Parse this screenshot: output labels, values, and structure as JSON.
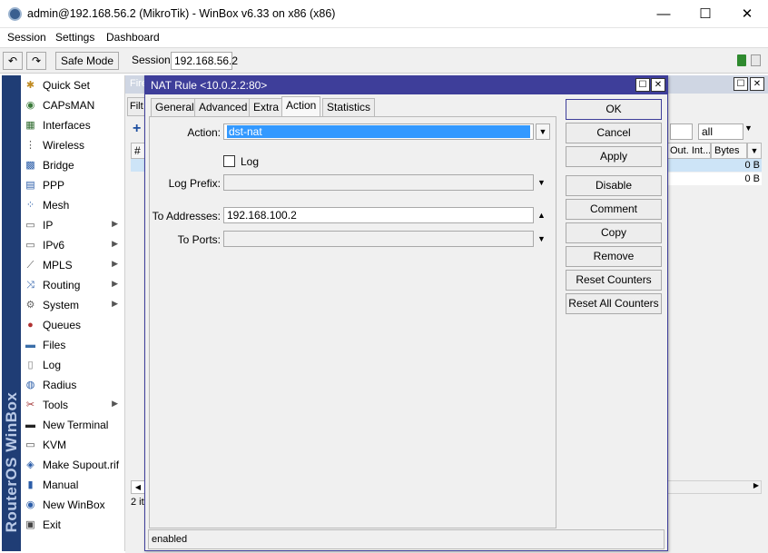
{
  "window": {
    "title": "admin@192.168.56.2 (MikroTik) - WinBox v6.33 on x86 (x86)",
    "controls": {
      "minimize": "—",
      "maximize": "☐",
      "close": "✕"
    }
  },
  "menu": [
    "Session",
    "Settings",
    "Dashboard"
  ],
  "toolbar": {
    "undo_icon": "↶",
    "redo_icon": "↷",
    "safe_mode": "Safe Mode",
    "session_label": "Session:",
    "session_value": "192.168.56.2"
  },
  "sidebar": {
    "brand": "RouterOS WinBox",
    "items": [
      {
        "label": "Quick Set",
        "icon": "quickset-icon",
        "glyph": "✱",
        "color": "#c08a20",
        "sub": false
      },
      {
        "label": "CAPsMAN",
        "icon": "capsman-icon",
        "glyph": "◉",
        "color": "#3a7a3a",
        "sub": false
      },
      {
        "label": "Interfaces",
        "icon": "interfaces-icon",
        "glyph": "▦",
        "color": "#2f6b2f",
        "sub": false
      },
      {
        "label": "Wireless",
        "icon": "wireless-icon",
        "glyph": "⋮",
        "color": "#555555",
        "sub": false
      },
      {
        "label": "Bridge",
        "icon": "bridge-icon",
        "glyph": "▩",
        "color": "#2b5da8",
        "sub": false
      },
      {
        "label": "PPP",
        "icon": "ppp-icon",
        "glyph": "▤",
        "color": "#2b5da8",
        "sub": false
      },
      {
        "label": "Mesh",
        "icon": "mesh-icon",
        "glyph": "⁘",
        "color": "#2b5da8",
        "sub": false
      },
      {
        "label": "IP",
        "icon": "ip-icon",
        "glyph": "▭",
        "color": "#555555",
        "sub": true
      },
      {
        "label": "IPv6",
        "icon": "ipv6-icon",
        "glyph": "▭",
        "color": "#555555",
        "sub": true
      },
      {
        "label": "MPLS",
        "icon": "mpls-icon",
        "glyph": "⟋",
        "color": "#555555",
        "sub": true
      },
      {
        "label": "Routing",
        "icon": "routing-icon",
        "glyph": "⤨",
        "color": "#2b5da8",
        "sub": true
      },
      {
        "label": "System",
        "icon": "system-icon",
        "glyph": "⚙",
        "color": "#666666",
        "sub": true
      },
      {
        "label": "Queues",
        "icon": "queues-icon",
        "glyph": "●",
        "color": "#b03030",
        "sub": false
      },
      {
        "label": "Files",
        "icon": "files-icon",
        "glyph": "▬",
        "color": "#3a6ea8",
        "sub": false
      },
      {
        "label": "Log",
        "icon": "log-icon",
        "glyph": "▯",
        "color": "#777777",
        "sub": false
      },
      {
        "label": "Radius",
        "icon": "radius-icon",
        "glyph": "◍",
        "color": "#2b5da8",
        "sub": false
      },
      {
        "label": "Tools",
        "icon": "tools-icon",
        "glyph": "✂",
        "color": "#a03030",
        "sub": true
      },
      {
        "label": "New Terminal",
        "icon": "terminal-icon",
        "glyph": "▬",
        "color": "#222222",
        "sub": false
      },
      {
        "label": "KVM",
        "icon": "kvm-icon",
        "glyph": "▭",
        "color": "#444444",
        "sub": false
      },
      {
        "label": "Make Supout.rif",
        "icon": "supout-icon",
        "glyph": "◈",
        "color": "#2b5da8",
        "sub": false
      },
      {
        "label": "Manual",
        "icon": "manual-icon",
        "glyph": "▮",
        "color": "#2b5da8",
        "sub": false
      },
      {
        "label": "New WinBox",
        "icon": "winbox-icon",
        "glyph": "◉",
        "color": "#2b5da8",
        "sub": false
      },
      {
        "label": "Exit",
        "icon": "exit-icon",
        "glyph": "▣",
        "color": "#444444",
        "sub": false
      }
    ]
  },
  "firewall": {
    "title_partial": "Fire",
    "tab_partial": "Filt",
    "add_icon": "+",
    "filter_value": "all",
    "col_hash": "#",
    "col_out_int": "Out. Int...",
    "col_bytes": "Bytes",
    "rows": [
      {
        "bytes": "0 B"
      },
      {
        "bytes": "0 B"
      }
    ],
    "count_partial": "2 it"
  },
  "dialog": {
    "title": "NAT Rule <10.0.2.2:80>",
    "tabs": [
      "General",
      "Advanced",
      "Extra",
      "Action",
      "Statistics"
    ],
    "active_tab": "Action",
    "fields": {
      "action_label": "Action:",
      "action_value": "dst-nat",
      "log_label": "Log",
      "log_prefix_label": "Log Prefix:",
      "log_prefix_value": "",
      "to_addresses_label": "To Addresses:",
      "to_addresses_value": "192.168.100.2",
      "to_ports_label": "To Ports:",
      "to_ports_value": ""
    },
    "buttons": [
      "OK",
      "Cancel",
      "Apply",
      "Disable",
      "Comment",
      "Copy",
      "Remove",
      "Reset Counters",
      "Reset All Counters"
    ],
    "status": "enabled"
  },
  "colors": {
    "dialog_title": "#3e3e9a",
    "sidebar_strip": "#1f3d75",
    "selection": "#3399ff",
    "lock_green": "#2f8a2f"
  }
}
